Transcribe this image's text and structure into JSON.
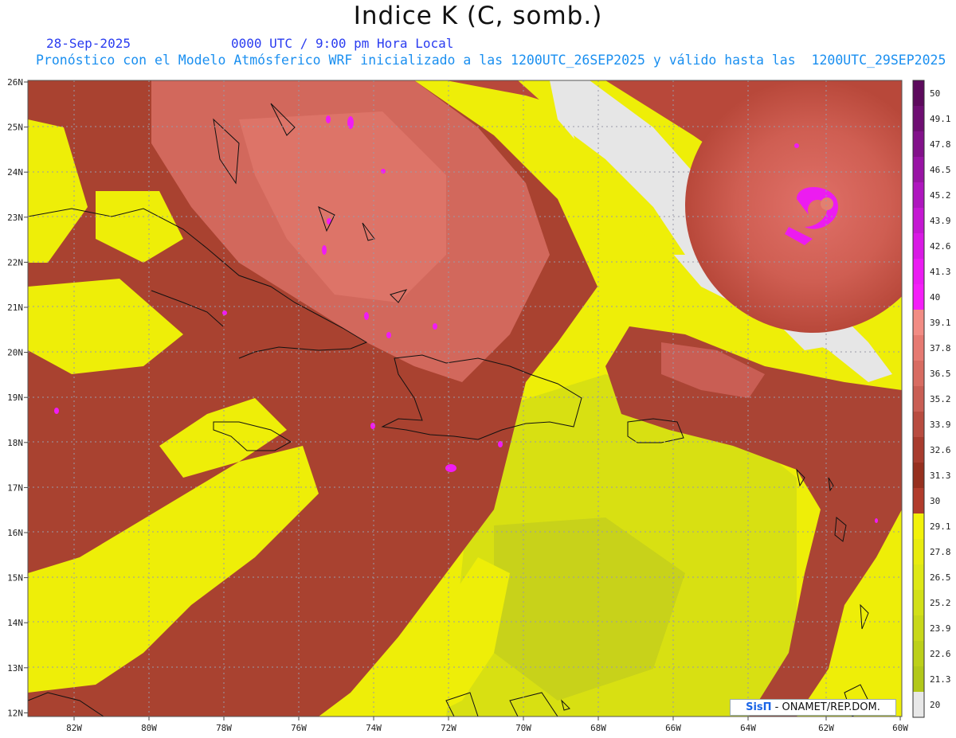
{
  "header": {
    "title": "Indice K (C, somb.)",
    "date": "28-Sep-2025",
    "time": "0000 UTC / 9:00 pm Hora Local",
    "model_line": "Pronóstico con el Modelo Atmósferico WRF inicializado a las 1200UTC_26SEP2025 y válido hasta las  1200UTC_29SEP2025"
  },
  "axes": {
    "lat_labels": [
      "26N",
      "25N",
      "24N",
      "23N",
      "22N",
      "21N",
      "20N",
      "19N",
      "18N",
      "17N",
      "16N",
      "15N",
      "14N",
      "13N",
      "12N"
    ],
    "lon_labels": [
      "82W",
      "80W",
      "78W",
      "76W",
      "74W",
      "72W",
      "70W",
      "68W",
      "66W",
      "64W",
      "62W",
      "60W"
    ]
  },
  "legend": {
    "labels": [
      "50",
      "49.1",
      "47.8",
      "46.5",
      "45.2",
      "43.9",
      "42.6",
      "41.3",
      "40",
      "39.1",
      "37.8",
      "36.5",
      "35.2",
      "33.9",
      "32.6",
      "31.3",
      "30",
      "29.1",
      "27.8",
      "26.5",
      "25.2",
      "23.9",
      "22.6",
      "21.3",
      "20"
    ],
    "colors": [
      "#5c0a5c",
      "#6e0e72",
      "#82118a",
      "#9814a4",
      "#ae16be",
      "#c418d2",
      "#d81ae4",
      "#ea1cf2",
      "#f41ff8",
      "#f28c84",
      "#e67a72",
      "#d86c62",
      "#c95e54",
      "#b84c40",
      "#a83c2e",
      "#96301f",
      "#b13c2c",
      "#f2f20a",
      "#e8ec10",
      "#dee816",
      "#d2e018",
      "#c8d81a",
      "#bcd01a",
      "#b2c81a",
      "#e8e8e8"
    ]
  },
  "credit": {
    "brand": "SisΠ",
    "text": " - ONAMET/REP.DOM."
  }
}
